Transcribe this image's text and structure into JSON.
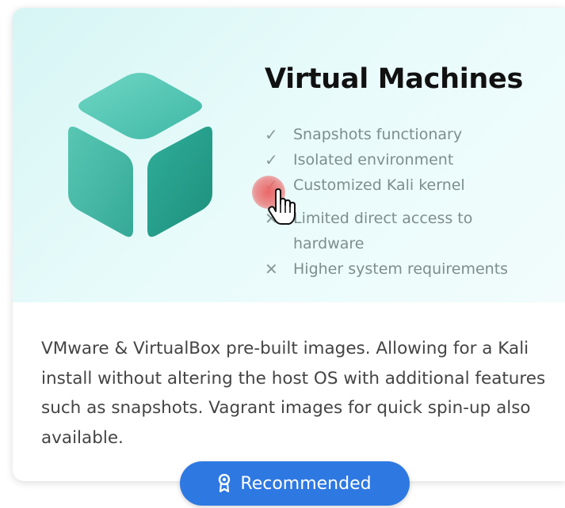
{
  "card": {
    "title": "Virtual Machines",
    "features": [
      {
        "kind": "pro",
        "icon": "check-icon",
        "text": "Snapshots functionary"
      },
      {
        "kind": "pro",
        "icon": "check-icon",
        "text": "Isolated environment"
      },
      {
        "kind": "pro",
        "icon": "check-icon",
        "text": "Customized Kali kernel"
      },
      {
        "kind": "con",
        "icon": "cross-icon",
        "text": "Limited direct access to hardware"
      },
      {
        "kind": "con",
        "icon": "cross-icon",
        "text": "Higher system requirements"
      }
    ],
    "description": "VMware & VirtualBox pre-built images. Allowing for a Kali install without altering the host OS with additional features such as snapshots. Vagrant images for quick spin-up also available.",
    "badge_label": "Recommended",
    "badge_icon": "award-ribbon-icon"
  },
  "colors": {
    "hero_background": "#d6f5f4",
    "cube": "#3dbba8",
    "badge": "#2e78e2",
    "feature_text": "#7d8e8d"
  }
}
